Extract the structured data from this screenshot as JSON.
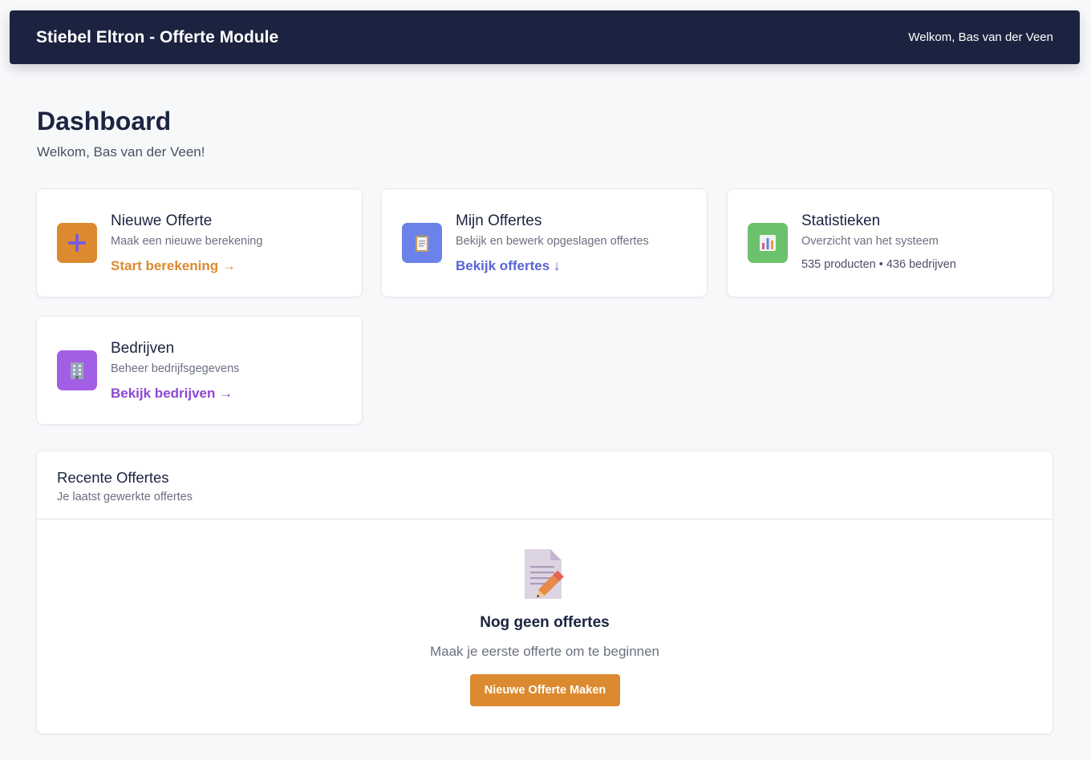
{
  "header": {
    "app_title": "Stiebel Eltron - Offerte Module",
    "user_greeting": "Welkom, Bas van der Veen"
  },
  "page": {
    "title": "Dashboard",
    "subtitle": "Welkom, Bas van der Veen!"
  },
  "cards": [
    {
      "title": "Nieuwe Offerte",
      "description": "Maak een nieuwe berekening",
      "link": "Start berekening →",
      "icon": "plus-icon",
      "icon_bg": "#dc8a2f",
      "link_color": "#dc8a2f"
    },
    {
      "title": "Mijn Offertes",
      "description": "Bekijk en bewerk opgeslagen offertes",
      "link": "Bekijk offertes ↓",
      "icon": "clipboard-icon",
      "icon_bg": "#6b82ea",
      "link_color": "#5a64d6"
    },
    {
      "title": "Statistieken",
      "description": "Overzicht van het systeem",
      "stats": "535 producten • 436 bedrijven",
      "icon": "bar-chart-icon",
      "icon_bg": "#6cc26c"
    },
    {
      "title": "Bedrijven",
      "description": "Beheer bedrijfsgegevens",
      "link": "Bekijk bedrijven →",
      "icon": "office-building-icon",
      "icon_bg": "#a35ee6",
      "link_color": "#8d47d6"
    }
  ],
  "recent": {
    "title": "Recente Offertes",
    "subtitle": "Je laatst gewerkte offertes",
    "empty_icon": "document-pencil-icon",
    "empty_title": "Nog geen offertes",
    "empty_description": "Maak je eerste offerte om te beginnen",
    "cta_label": "Nieuwe Offerte Maken"
  }
}
